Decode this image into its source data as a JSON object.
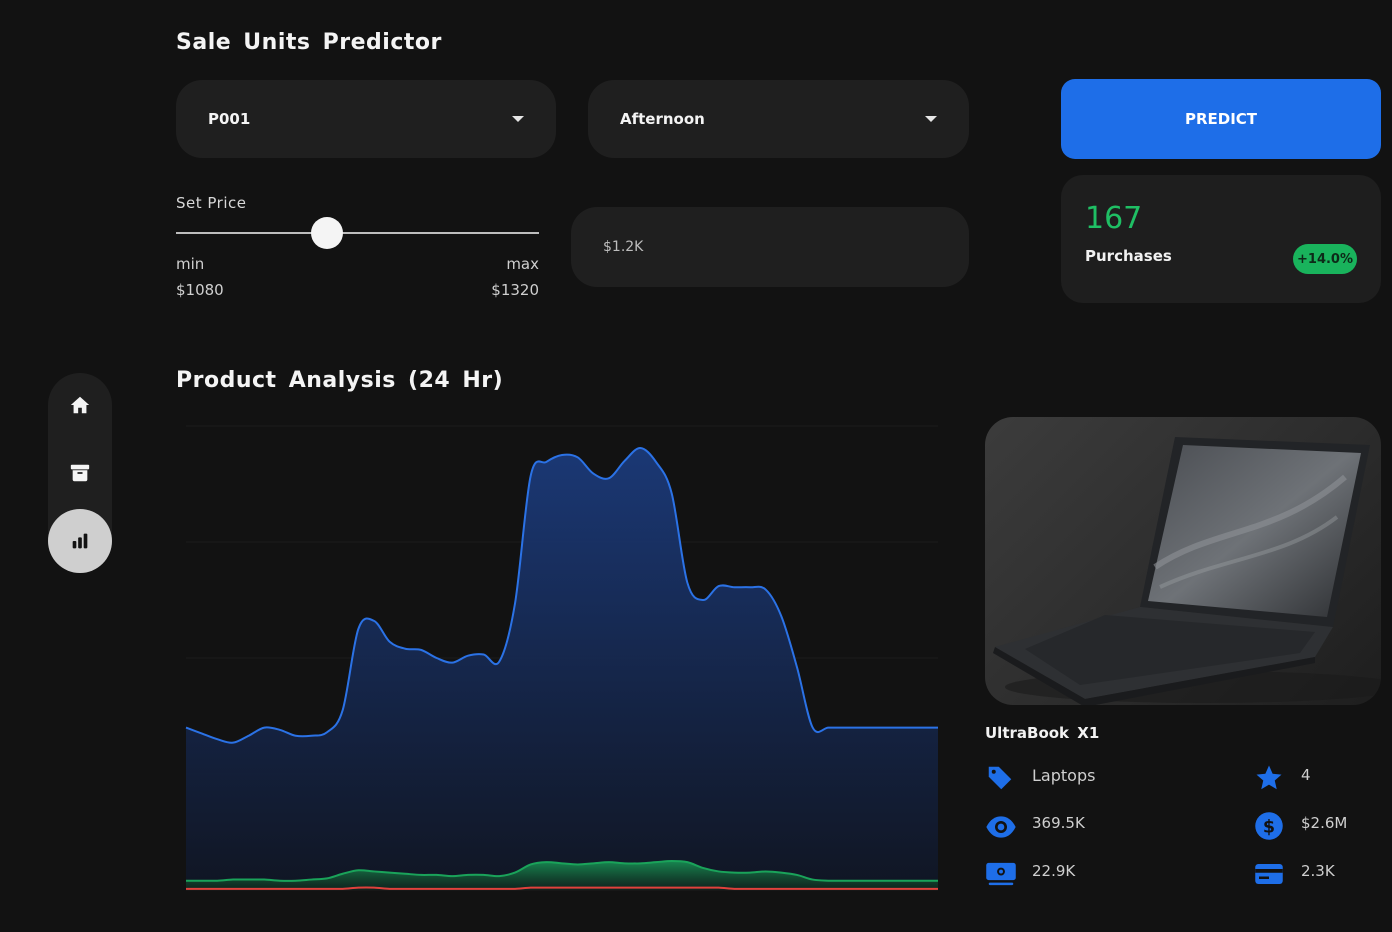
{
  "header": {
    "title": "Sale Units Predictor"
  },
  "controls": {
    "product_select": "P001",
    "time_select": "Afternoon",
    "predict_label": "PREDICT",
    "price_label": "Set Price",
    "slider_fraction": 0.415,
    "min_label": "min",
    "max_label": "max",
    "min_value": "$1080",
    "max_value": "$1320",
    "price_display": "$1.2K"
  },
  "result": {
    "value": "167",
    "label": "Purchases",
    "change": "+14.0%"
  },
  "analysis": {
    "title": "Product Analysis (24 Hr)"
  },
  "product": {
    "name": "UltraBook X1",
    "category": "Laptops",
    "rating": "4",
    "views": "369.5K",
    "revenue": "$2.6M",
    "sales": "22.9K",
    "transactions": "2.3K"
  },
  "colors": {
    "accent": "#1e6ee8",
    "positive": "#19b35c",
    "line_blue": "#2b72e6",
    "line_green": "#1aa35a",
    "line_red": "#e0413c"
  },
  "chart_data": {
    "type": "area",
    "title": "",
    "xlabel": "",
    "ylabel": "",
    "x": [
      0,
      1,
      2,
      3,
      4,
      5,
      6,
      7,
      8,
      9,
      10,
      11,
      12,
      13,
      14,
      15,
      16,
      17,
      18,
      19,
      20,
      21,
      22,
      23,
      24,
      25,
      26,
      27,
      28,
      29,
      30,
      31,
      32,
      33,
      34,
      35,
      36,
      37,
      38,
      39,
      40,
      41,
      42,
      43,
      44,
      45,
      46,
      47,
      48
    ],
    "ylim": [
      0,
      400
    ],
    "grid": true,
    "series": [
      {
        "values": [
          140,
          135,
          130,
          127,
          133,
          140,
          138,
          133,
          133,
          136,
          155,
          225,
          232,
          214,
          208,
          207,
          200,
          196,
          202,
          203,
          197,
          247,
          357,
          369,
          375,
          373,
          359,
          355,
          370,
          381,
          369,
          342,
          265,
          250,
          262,
          261,
          261,
          259,
          236,
          192,
          140,
          140,
          140,
          140,
          140,
          140,
          140,
          140,
          140
        ]
      },
      {
        "values": [
          8,
          8,
          8,
          9,
          9,
          9,
          8,
          8,
          9,
          10,
          14,
          17,
          16,
          15,
          14,
          13,
          13,
          12,
          13,
          13,
          12,
          15,
          22,
          24,
          23,
          22,
          23,
          24,
          23,
          23,
          24,
          25,
          24,
          19,
          16,
          15,
          15,
          16,
          15,
          13,
          9,
          8,
          8,
          8,
          8,
          8,
          8,
          8,
          8
        ]
      },
      {
        "values": [
          1,
          1,
          1,
          1,
          1,
          1,
          1,
          1,
          1,
          1,
          1,
          2,
          2,
          1,
          1,
          1,
          1,
          1,
          1,
          1,
          1,
          1,
          2,
          2,
          2,
          2,
          2,
          2,
          2,
          2,
          2,
          2,
          2,
          2,
          2,
          1,
          1,
          1,
          1,
          1,
          1,
          1,
          1,
          1,
          1,
          1,
          1,
          1,
          1
        ]
      }
    ]
  }
}
